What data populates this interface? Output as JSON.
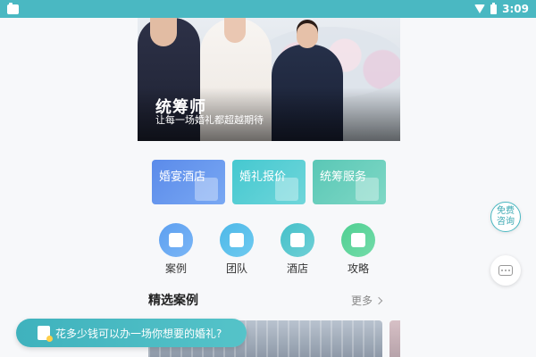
{
  "status_bar": {
    "time": "3:09"
  },
  "hero": {
    "title": "统筹师",
    "subtitle": "让每一场婚礼都超越期待"
  },
  "service_cards": [
    {
      "label": "婚宴酒店",
      "color": "#5b8bea"
    },
    {
      "label": "婚礼报价",
      "color": "#45c8d0"
    },
    {
      "label": "统筹服务",
      "color": "#5ac7b6"
    }
  ],
  "nav": [
    {
      "label": "案例",
      "icon": "case-icon",
      "color": "#5d9ff0"
    },
    {
      "label": "团队",
      "icon": "team-icon",
      "color": "#4db8e8"
    },
    {
      "label": "酒店",
      "icon": "hotel-icon",
      "color": "#45c0c9"
    },
    {
      "label": "攻略",
      "icon": "guide-icon",
      "color": "#4fcf92"
    }
  ],
  "featured": {
    "title": "精选案例",
    "more": "更多"
  },
  "float_buttons": {
    "free_line1": "免费",
    "free_line2": "咨询"
  },
  "bottom_banner": {
    "text": "花多少钱可以办一场你想要的婚礼?"
  }
}
